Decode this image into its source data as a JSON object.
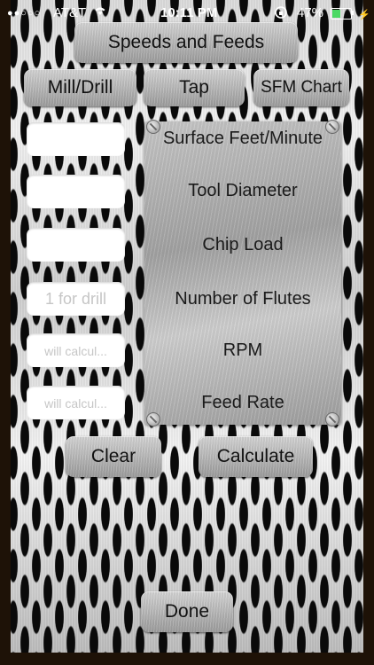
{
  "status": {
    "signal": "●●○○○",
    "carrier": "AT&T",
    "wifi": "wifi-icon",
    "time": "10:11 PM",
    "battery_pct": "47%",
    "battery_level": 0.47
  },
  "title": "Speeds and Feeds",
  "nav": {
    "mill_drill": "Mill/Drill",
    "tap": "Tap",
    "sfm_chart": "SFM Chart"
  },
  "fields": {
    "sfm": {
      "value": "",
      "placeholder": ""
    },
    "tool_diameter": {
      "value": "",
      "placeholder": ""
    },
    "chip_load": {
      "value": "",
      "placeholder": ""
    },
    "flutes": {
      "value": "",
      "placeholder": "1 for drill"
    },
    "rpm": {
      "value": "",
      "placeholder": "will calcul..."
    },
    "feed_rate": {
      "value": "",
      "placeholder": "will calcul..."
    }
  },
  "labels": {
    "sfm": "Surface Feet/Minute",
    "tool_diameter": "Tool Diameter",
    "chip_load": "Chip Load",
    "flutes": "Number of Flutes",
    "rpm": "RPM",
    "feed_rate": "Feed Rate"
  },
  "actions": {
    "clear": "Clear",
    "calculate": "Calculate",
    "done": "Done"
  }
}
